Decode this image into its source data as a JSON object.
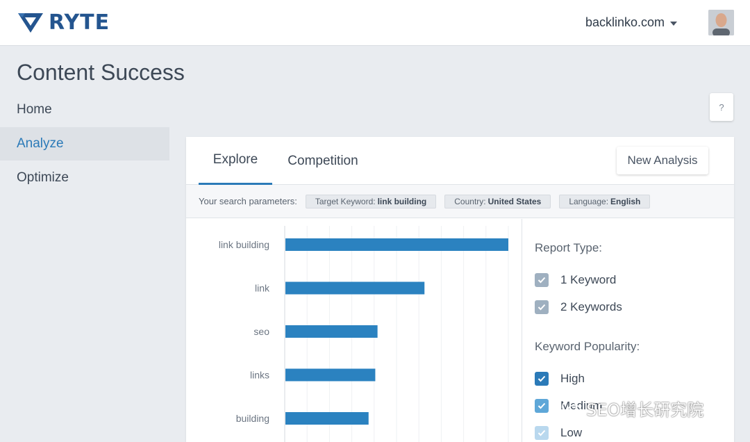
{
  "app": {
    "logo_text": "RYTE"
  },
  "header": {
    "domain": "backlinko.com",
    "avatar_icon": "user-avatar"
  },
  "sidebar": {
    "title": "Content Success",
    "items": [
      {
        "label": "Home",
        "active": false
      },
      {
        "label": "Analyze",
        "active": true
      },
      {
        "label": "Optimize",
        "active": false
      }
    ]
  },
  "help": {
    "label": "?"
  },
  "panel": {
    "tabs": [
      {
        "label": "Explore",
        "active": true
      },
      {
        "label": "Competition",
        "active": false
      }
    ],
    "new_analysis_label": "New Analysis",
    "params": {
      "intro": "Your search parameters:",
      "chips": [
        {
          "key": "Target Keyword:",
          "value": "link building"
        },
        {
          "key": "Country:",
          "value": "United States"
        },
        {
          "key": "Language:",
          "value": "English"
        }
      ]
    },
    "filters": {
      "report_type": {
        "heading": "Report Type:",
        "options": [
          {
            "label": "1 Keyword",
            "checked": true,
            "tone": "muted"
          },
          {
            "label": "2 Keywords",
            "checked": true,
            "tone": "muted"
          }
        ]
      },
      "keyword_popularity": {
        "heading": "Keyword Popularity:",
        "options": [
          {
            "label": "High",
            "checked": true,
            "tone": "strong"
          },
          {
            "label": "Medium",
            "checked": true,
            "tone": "medium"
          },
          {
            "label": "Low",
            "checked": true,
            "tone": "light"
          }
        ]
      }
    }
  },
  "colors": {
    "accent": "#2b7ab8",
    "bar": "#2b82c0",
    "logo": "#24558f"
  },
  "chart_data": {
    "type": "bar",
    "orientation": "horizontal",
    "categories": [
      "link building",
      "link",
      "seo",
      "links",
      "building"
    ],
    "values": [
      100,
      62.5,
      41.5,
      40.5,
      37.5
    ],
    "xlim": [
      0,
      100
    ],
    "grid": true,
    "title": "",
    "xlabel": "",
    "ylabel": ""
  },
  "watermark": {
    "text": "SEO增长研究院"
  }
}
